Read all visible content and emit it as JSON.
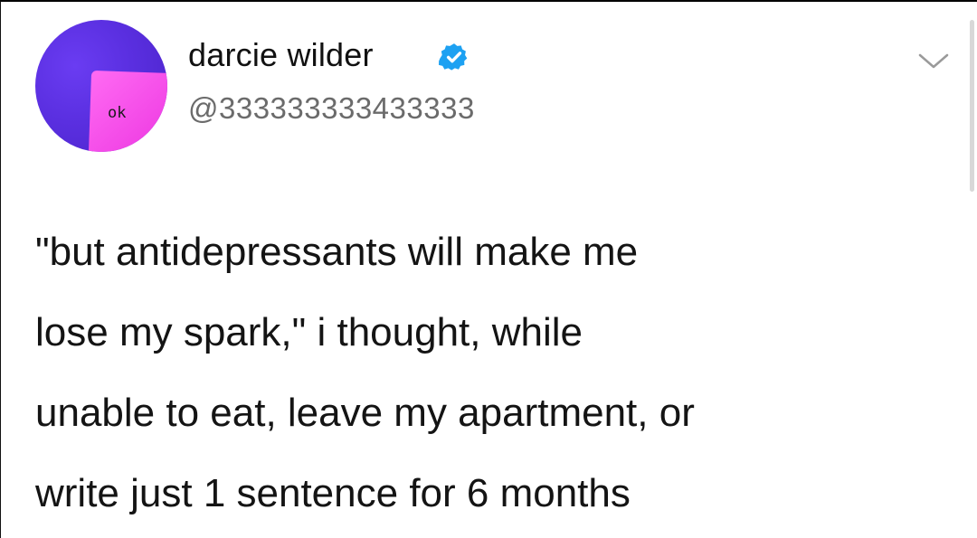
{
  "tweet": {
    "display_name": "darcie wilder",
    "handle": "@333333333433333",
    "avatar_text": "ok",
    "verified": true,
    "verified_icon": "verified-badge-icon",
    "menu_icon": "chevron-down-icon",
    "text_lines": [
      "\"but antidepressants will make me",
      "lose my spark,\" i thought, while",
      "unable to eat, leave my apartment, or",
      "write just 1 sentence for 6 months"
    ]
  },
  "colors": {
    "verified_blue": "#1da1f2",
    "avatar_purple": "#5a2fe0",
    "avatar_pink": "#f040e4",
    "handle_gray": "#6b6b6b"
  }
}
